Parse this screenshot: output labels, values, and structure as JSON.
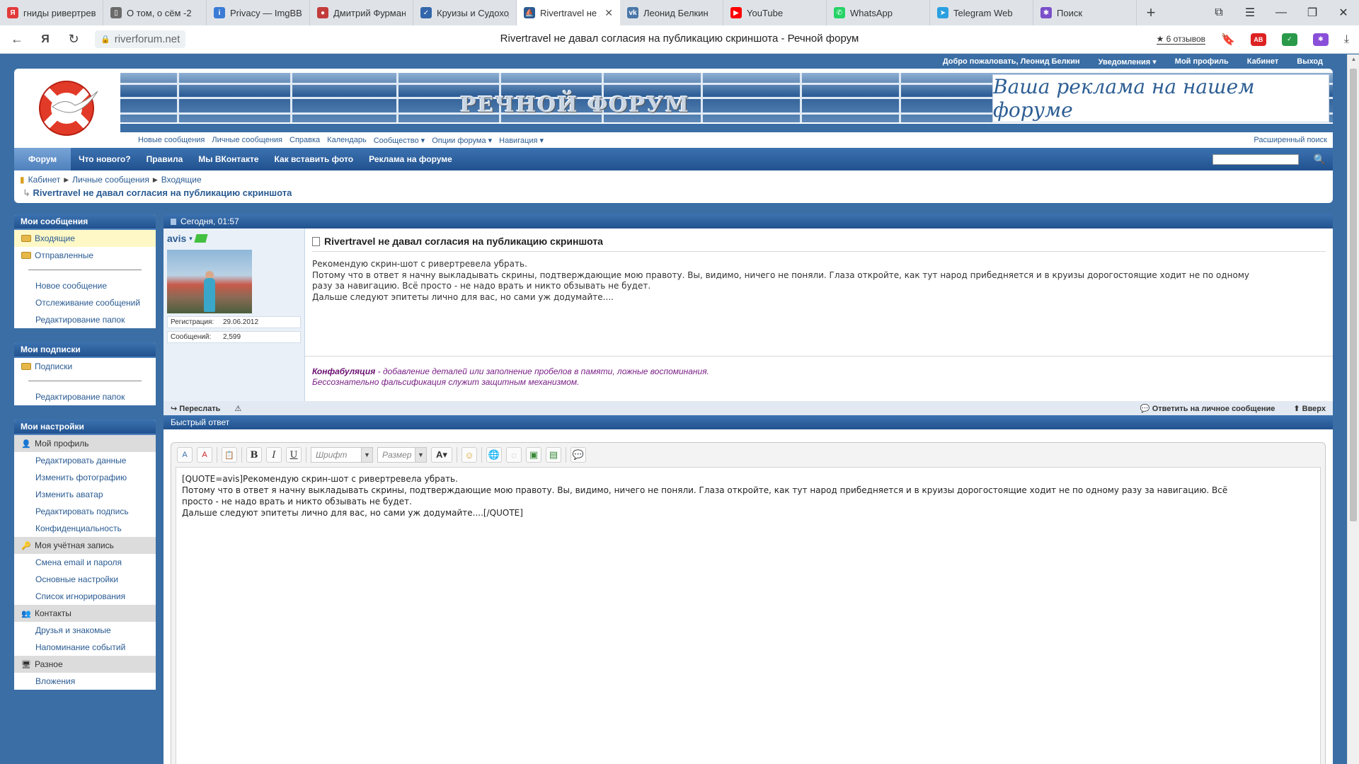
{
  "browser": {
    "tabs": [
      {
        "title": "гниды ривертревел",
        "color": "#e23a3a",
        "glyph": "Я"
      },
      {
        "title": "О том, о сём -2",
        "color": "#6b6b6b",
        "glyph": "▯"
      },
      {
        "title": "Privacy — ImgBB",
        "color": "#3a7bd5",
        "glyph": "i"
      },
      {
        "title": "Дмитрий Фурман",
        "color": "#c23c3c",
        "glyph": "●"
      },
      {
        "title": "Круизы и Судоход",
        "color": "#3366aa",
        "glyph": "✓"
      },
      {
        "title": "Rivertravel не д",
        "color": "#2a5b92",
        "glyph": "⛵",
        "active": true
      },
      {
        "title": "Леонид Белкин",
        "color": "#4a76a8",
        "glyph": "vk"
      },
      {
        "title": "YouTube",
        "color": "#ff0000",
        "glyph": "▶"
      },
      {
        "title": "WhatsApp",
        "color": "#25d366",
        "glyph": "✆"
      },
      {
        "title": "Telegram Web",
        "color": "#2aa0e0",
        "glyph": "➤"
      },
      {
        "title": "Поиск",
        "color": "#7a4fc9",
        "glyph": "✱"
      }
    ],
    "url": "riverforum.net",
    "page_title": "Rivertravel не давал согласия на публикацию скриншота - Речной форум",
    "reviews": "★ 6 отзывов"
  },
  "topbar": {
    "welcome": "Добро пожаловать,",
    "username": "Леонид Белкин",
    "notifications": "Уведомления ▾",
    "profile": "Мой профиль",
    "cabinet": "Кабинет",
    "logout": "Выход"
  },
  "header": {
    "forum_title": "РЕЧНОЙ ФОРУМ",
    "ad_text": "Ваша реклама на нашем форуме",
    "subnav": [
      "Новые сообщения",
      "Личные сообщения",
      "Справка",
      "Календарь",
      "Сообщество ▾",
      "Опции форума ▾",
      "Навигация ▾"
    ],
    "advanced_search": "Расширенный поиск"
  },
  "mainnav": [
    "Форум",
    "Что нового?",
    "Правила",
    "Мы ВКонтакте",
    "Как вставить фото",
    "Реклама на форуме"
  ],
  "breadcrumb": {
    "items": [
      "Кабинет",
      "Личные сообщения",
      "Входящие"
    ],
    "current": "Rivertravel не давал согласия на публикацию скриншота"
  },
  "sidebar": {
    "messages": {
      "title": "Мои сообщения",
      "folders": [
        "Входящие",
        "Отправленные"
      ],
      "links": [
        "Новое сообщение",
        "Отслеживание сообщений",
        "Редактирование папок"
      ]
    },
    "subscriptions": {
      "title": "Мои подписки",
      "folders": [
        "Подписки"
      ],
      "links": [
        "Редактирование папок"
      ]
    },
    "settings": {
      "title": "Мои настройки",
      "profile": "Мой профиль",
      "profile_links": [
        "Редактировать данные",
        "Изменить фотографию",
        "Изменить аватар",
        "Редактировать подпись",
        "Конфиденциальность"
      ],
      "account": "Моя учётная запись",
      "account_links": [
        "Смена email и пароля",
        "Основные настройки",
        "Список игнорирования"
      ],
      "contacts": "Контакты",
      "contacts_links": [
        "Друзья и знакомые",
        "Напоминание событий"
      ],
      "misc": "Разное",
      "misc_links": [
        "Вложения"
      ]
    }
  },
  "message": {
    "date": "Сегодня, 01:57",
    "author": "avis",
    "reg_label": "Регистрация:",
    "reg_date": "29.06.2012",
    "posts_label": "Сообщений:",
    "posts": "2,599",
    "title": "Rivertravel не давал согласия на публикацию скриншота",
    "lines": [
      "Рекомендую скрин-шот с ривертревела убрать.",
      "Потому что в ответ я начну выкладывать скрины, подтверждающие мою правоту. Вы, видимо, ничего не поняли. Глаза откройте, как тут народ прибедняется и в круизы дорогостоящие ходит не по одному",
      "разу за навигацию. Всё просто - не надо врать и никто обзывать не будет.",
      "Дальше следуют эпитеты лично для вас, но сами уж додумайте...."
    ],
    "signature_term": "Конфабуляция",
    "signature_rest": " - добавление деталей или заполнение пробелов в памяти, ложные воспоминания.",
    "signature_line2": "Бессознательно фальсификация служит защитным механизмом.",
    "forward": "Переслать",
    "reply": "Ответить на личное сообщение",
    "top": "Вверх"
  },
  "quick_reply": {
    "title": "Быстрый ответ",
    "font_placeholder": "Шрифт",
    "size_placeholder": "Размер",
    "text": "[QUOTE=avis]Рекомендую скрин-шот с ривертревела убрать.\nПотому что в ответ я начну выкладывать скрины, подтверждающие мою правоту. Вы, видимо, ничего не поняли. Глаза откройте, как тут народ прибедняется и в круизы дорогостоящие ходит не по одному разу за навигацию. Всё\nпросто - не надо врать и никто обзывать не будет.\nДальше следуют эпитеты лично для вас, но сами уж додумайте....[/QUOTE]"
  }
}
